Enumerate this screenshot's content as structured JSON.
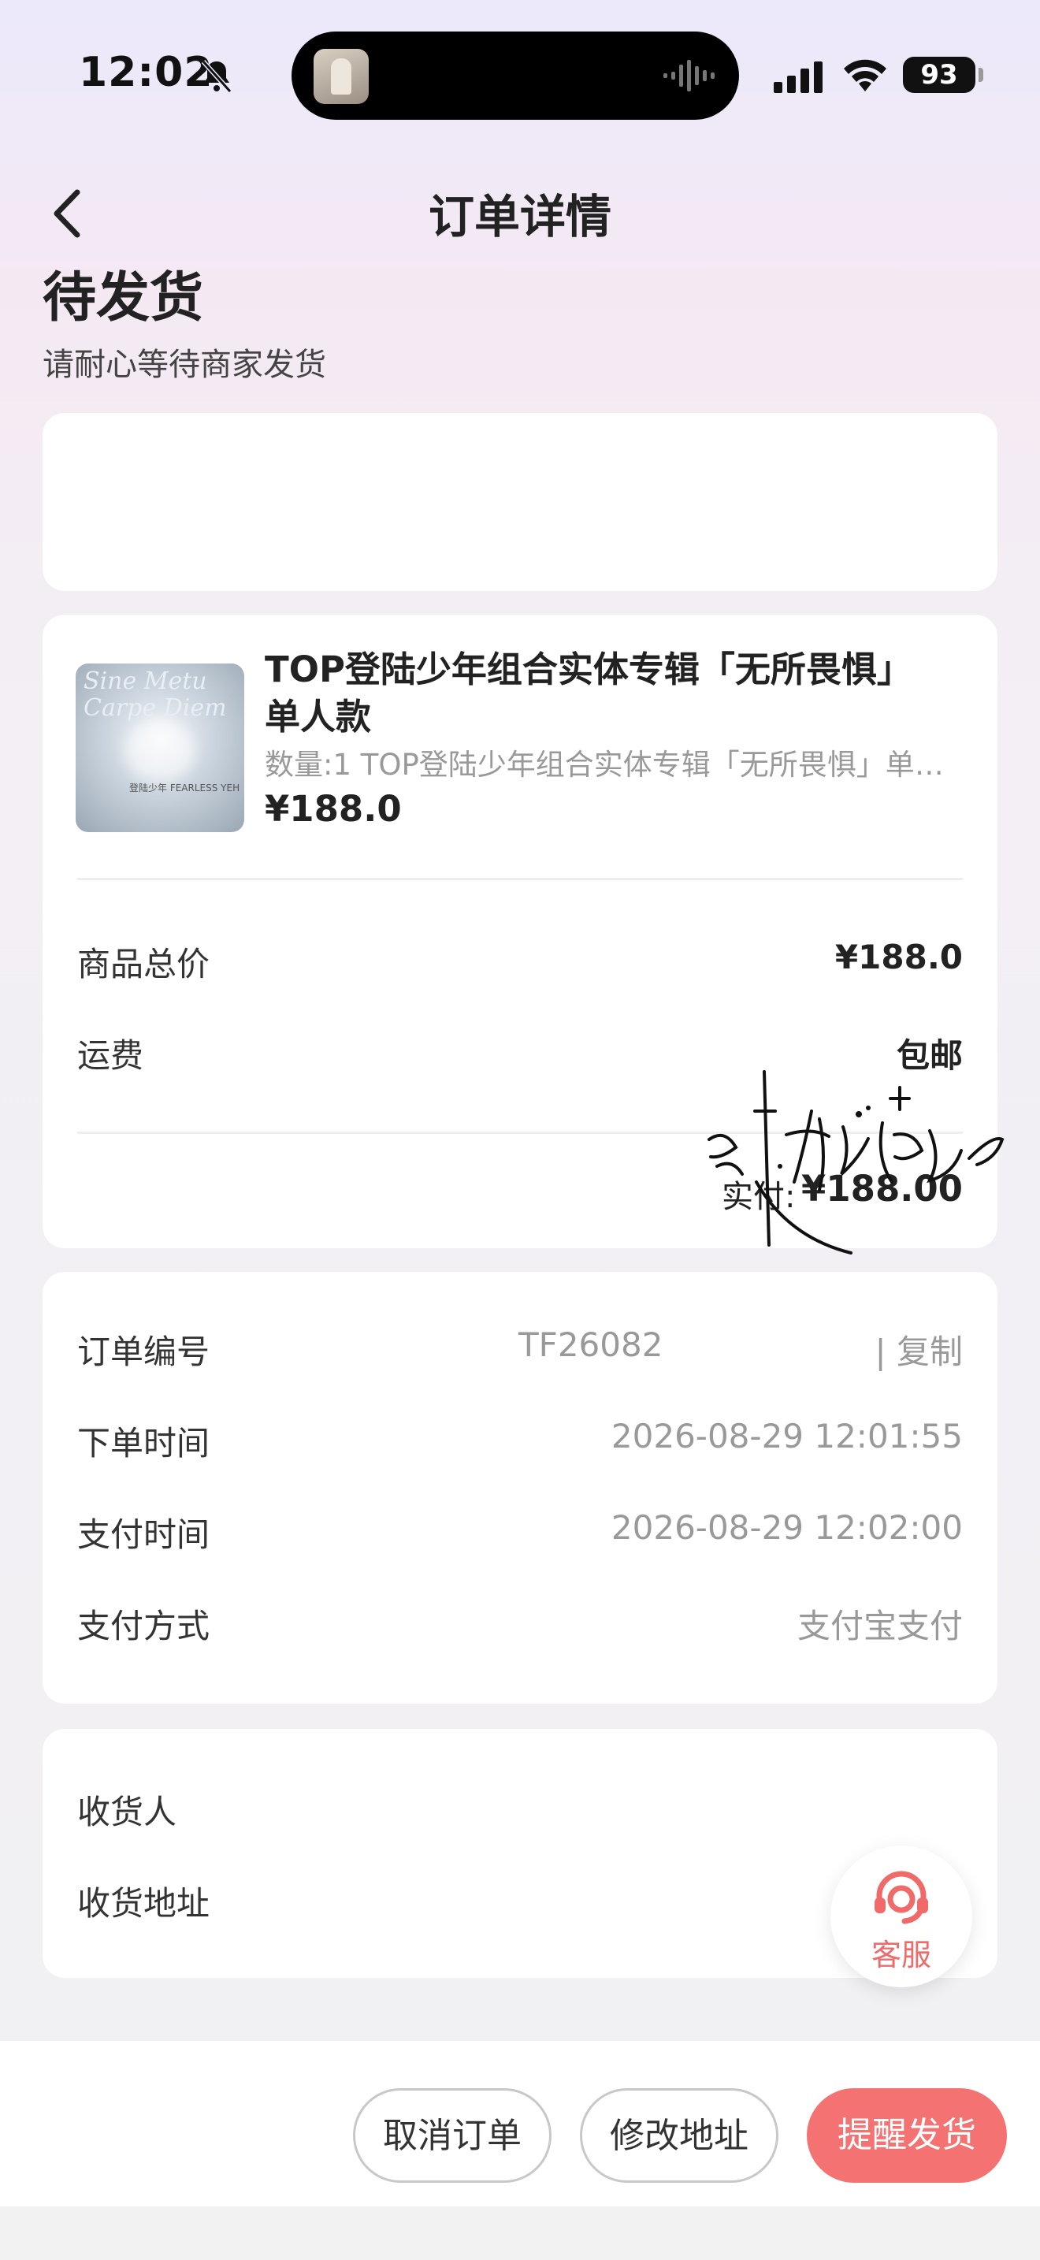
{
  "status_bar": {
    "time": "12:02",
    "battery": "93"
  },
  "nav": {
    "title": "订单详情"
  },
  "order_status": {
    "title": "待发货",
    "subtitle": "请耐心等待商家发货"
  },
  "product": {
    "title": "TOP登陆少年组合实体专辑「无所畏惧」单人款",
    "spec": "数量:1 TOP登陆少年组合实体专辑「无所畏惧」单人款",
    "price": "¥188.0",
    "thumb_text": "Sine Metu Carpe Diem",
    "thumb_caption": "登陆少年 FEARLESS YEH"
  },
  "price_summary": {
    "goods_total_label": "商品总价",
    "goods_total_value": "¥188.0",
    "shipping_label": "运费",
    "shipping_value": "包邮",
    "paid_label": "实付:",
    "paid_value": "¥188.00"
  },
  "order_info": {
    "order_no_label": "订单编号",
    "order_no_value": "TF26082",
    "copy_label": "| 复制",
    "order_time_label": "下单时间",
    "order_time_value": "2026-08-29 12:01:55",
    "pay_time_label": "支付时间",
    "pay_time_value": "2026-08-29 12:02:00",
    "pay_method_label": "支付方式",
    "pay_method_value": "支付宝支付"
  },
  "receiver": {
    "name_label": "收货人",
    "address_label": "收货地址"
  },
  "service": {
    "label": "客服"
  },
  "actions": {
    "cancel": "取消订单",
    "modify_address": "修改地址",
    "remind": "提醒发货"
  },
  "colors": {
    "accent": "#f47272",
    "service_text": "#f06a6a"
  }
}
